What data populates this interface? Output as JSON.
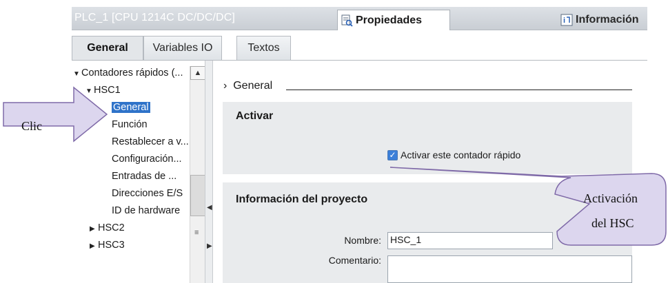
{
  "window": {
    "title": "PLC_1 [CPU 1214C DC/DC/DC]",
    "tab_properties": "Propiedades",
    "tab_info": "Información",
    "icons": [
      "properties-icon",
      "info-icon"
    ]
  },
  "tabs": [
    "General",
    "Variables IO",
    "Textos"
  ],
  "tree": {
    "root": "Contadores rápidos (...",
    "hsc1": "HSC1",
    "children": [
      "General",
      "Función",
      "Restablecer a v...",
      "Configuración...",
      "Entradas de ...",
      "Direcciones E/S",
      "ID de hardware"
    ],
    "hsc2": "HSC2",
    "hsc3": "HSC3"
  },
  "content": {
    "breadcrumb": "General",
    "section_activar": "Activar",
    "checkbox_label": "Activar este contador rápido",
    "checkbox_checked": true,
    "section_info": "Información del proyecto",
    "nombre_label": "Nombre:",
    "nombre_value": "HSC_1",
    "comentario_label": "Comentario:",
    "comentario_value": ""
  },
  "callouts": {
    "clic": "Clic",
    "activacion_line1": "Activación",
    "activacion_line2": "del HSC"
  },
  "colors": {
    "selection": "#2f73c9",
    "callout_fill": "#dcd6ee",
    "callout_stroke": "#7f6aa8"
  }
}
